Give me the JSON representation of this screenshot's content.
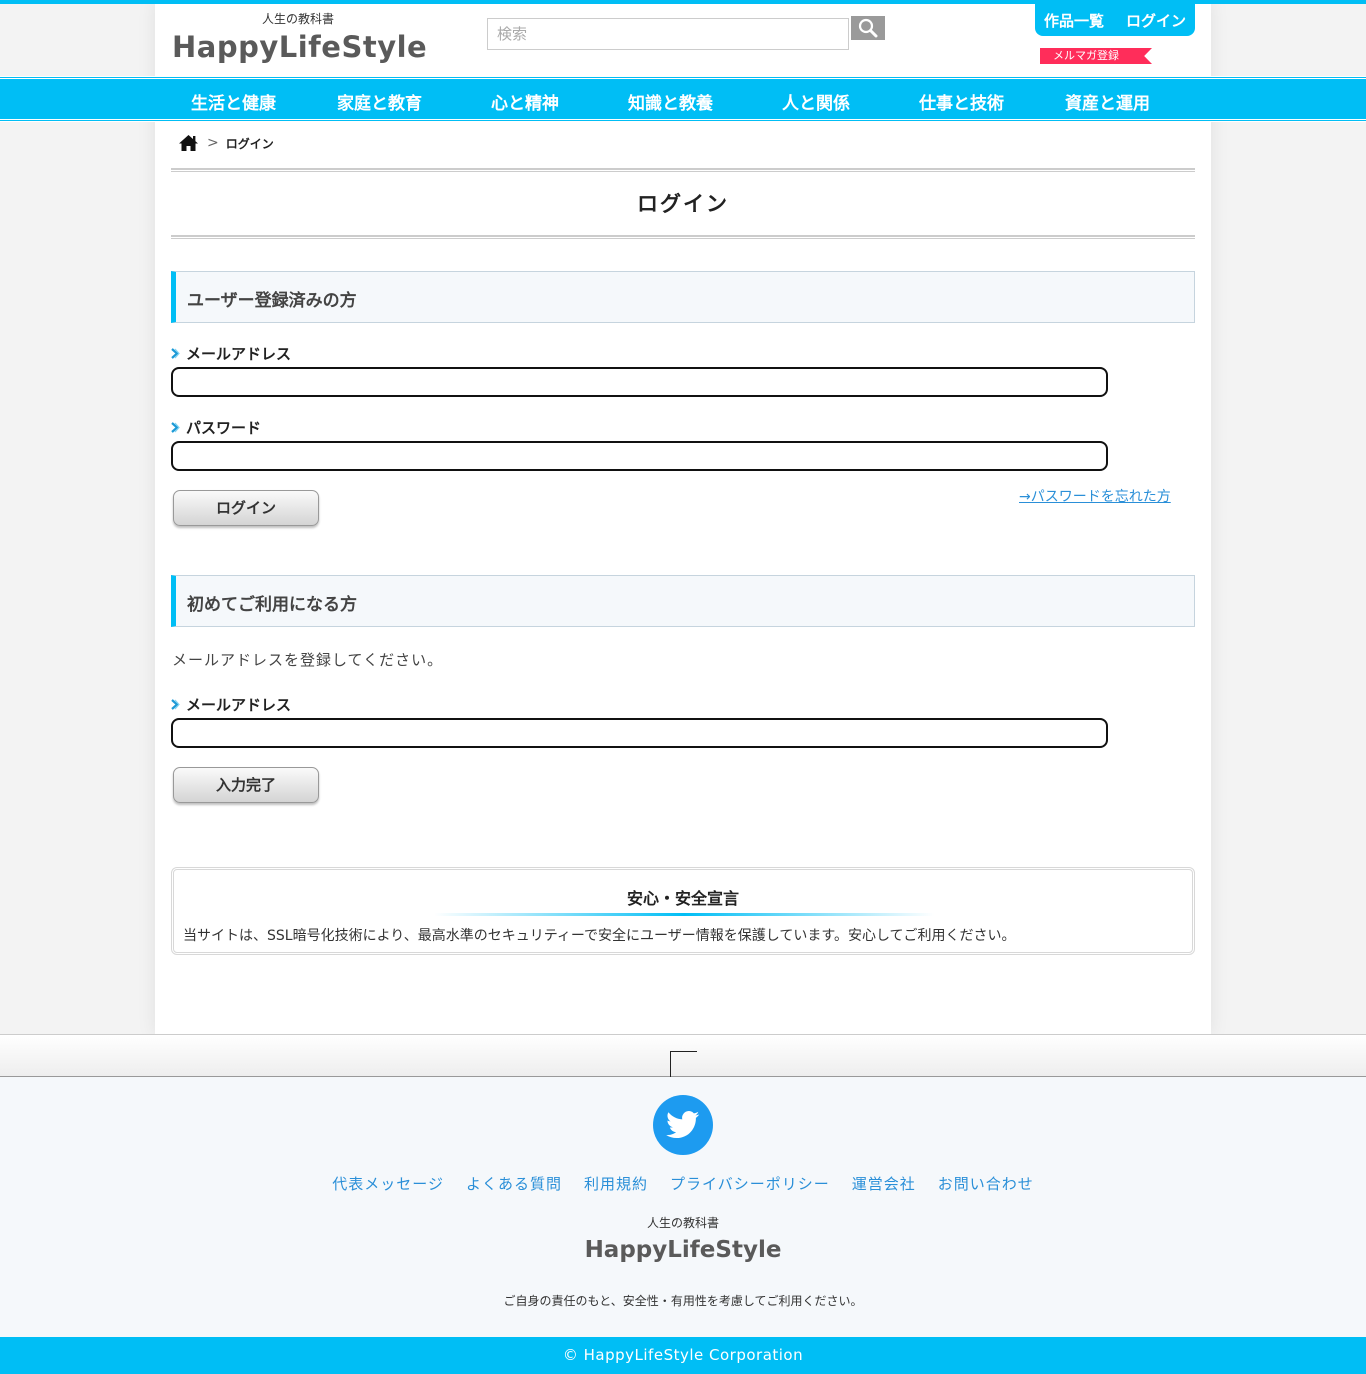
{
  "header": {
    "logo_sub": "人生の教科書",
    "logo_main": "HappyLifeStyle",
    "search_placeholder": "検索",
    "link_works": "作品一覧",
    "link_login": "ログイン",
    "mailmag": "メルマガ登録"
  },
  "nav": {
    "items": [
      "生活と健康",
      "家庭と教育",
      "心と精神",
      "知識と教養",
      "人と関係",
      "仕事と技術",
      "資産と運用"
    ]
  },
  "breadcrumb": {
    "separator": ">",
    "current": "ログイン"
  },
  "page_title": "ログイン",
  "registered": {
    "heading": "ユーザー登録済みの方",
    "email_label": "メールアドレス",
    "password_label": "パスワード",
    "login_button": "ログイン",
    "forgot_link": "→パスワードを忘れた方"
  },
  "first_time": {
    "heading": "初めてご利用になる方",
    "instruction": "メールアドレスを登録してください。",
    "email_label": "メールアドレス",
    "submit_button": "入力完了"
  },
  "security": {
    "title": "安心・安全宣言",
    "text": "当サイトは、SSL暗号化技術により、最高水準のセキュリティーで安全にユーザー情報を保護しています。安心してご利用ください。"
  },
  "footer": {
    "links": [
      "代表メッセージ",
      "よくある質問",
      "利用規約",
      "プライバシーポリシー",
      "運営会社",
      "お問い合わせ"
    ],
    "logo_sub": "人生の教科書",
    "logo_main": "HappyLifeStyle",
    "note": "ご自身の責任のもと、安全性・有用性を考慮してご利用ください。",
    "copyright": "© HappyLifeStyle Corporation"
  },
  "colors": {
    "accent": "#00bef5",
    "mailmag": "#ff2d5a",
    "link": "#2a8fd8",
    "twitter": "#1d9bf0"
  },
  "icons": [
    "search-icon",
    "home-icon",
    "chevron-right-icon",
    "twitter-icon",
    "pagetop-icon"
  ]
}
